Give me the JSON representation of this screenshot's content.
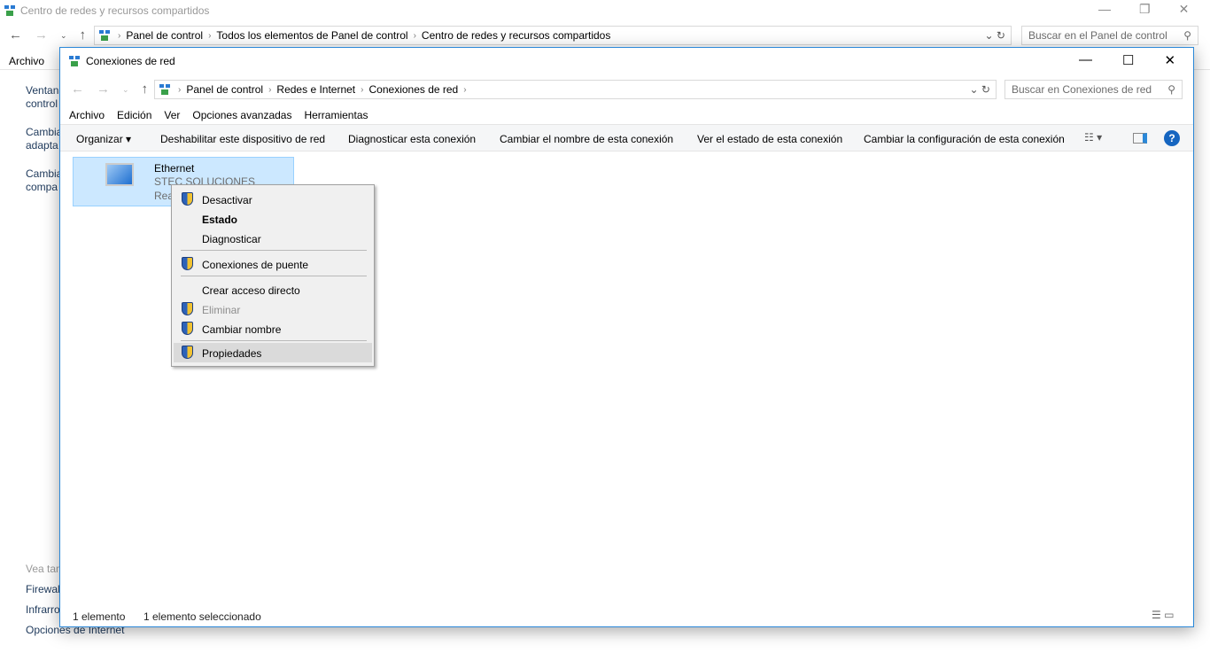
{
  "outer": {
    "title": "Centro de redes y recursos compartidos",
    "breadcrumbs": [
      "Panel de control",
      "Todos los elementos de Panel de control",
      "Centro de redes y recursos compartidos"
    ],
    "search_placeholder": "Buscar en el Panel de control",
    "menu": [
      "Archivo"
    ],
    "side_links": [
      "Ventana",
      "control",
      "Cambia",
      "adapta",
      "Cambia",
      "compa"
    ],
    "see_also": "Vea tam",
    "see_links": [
      "Firewal",
      "Infrarro",
      "Opciones de Internet"
    ]
  },
  "inner": {
    "title": "Conexiones de red",
    "breadcrumbs": [
      "Panel de control",
      "Redes e Internet",
      "Conexiones de red"
    ],
    "search_placeholder": "Buscar en Conexiones de red",
    "menu": [
      "Archivo",
      "Edición",
      "Ver",
      "Opciones avanzadas",
      "Herramientas"
    ],
    "toolbar": [
      "Organizar",
      "Deshabilitar este dispositivo de red",
      "Diagnosticar esta conexión",
      "Cambiar el nombre de esta conexión",
      "Ver el estado de esta conexión",
      "Cambiar la configuración de esta conexión"
    ],
    "item": {
      "name": "Ethernet",
      "network": "STEC SOLUCIONES",
      "adapter": "Rea"
    },
    "status": {
      "count": "1 elemento",
      "selected": "1 elemento seleccionado"
    }
  },
  "context_menu": [
    {
      "label": "Desactivar",
      "shield": true
    },
    {
      "label": "Estado",
      "bold": true
    },
    {
      "label": "Diagnosticar"
    },
    {
      "label": "Conexiones de puente",
      "shield": true
    },
    {
      "label": "Crear acceso directo"
    },
    {
      "label": "Eliminar",
      "shield": true,
      "disabled": true
    },
    {
      "label": "Cambiar nombre",
      "shield": true
    },
    {
      "label": "Propiedades",
      "shield": true,
      "highlighted": true
    }
  ]
}
